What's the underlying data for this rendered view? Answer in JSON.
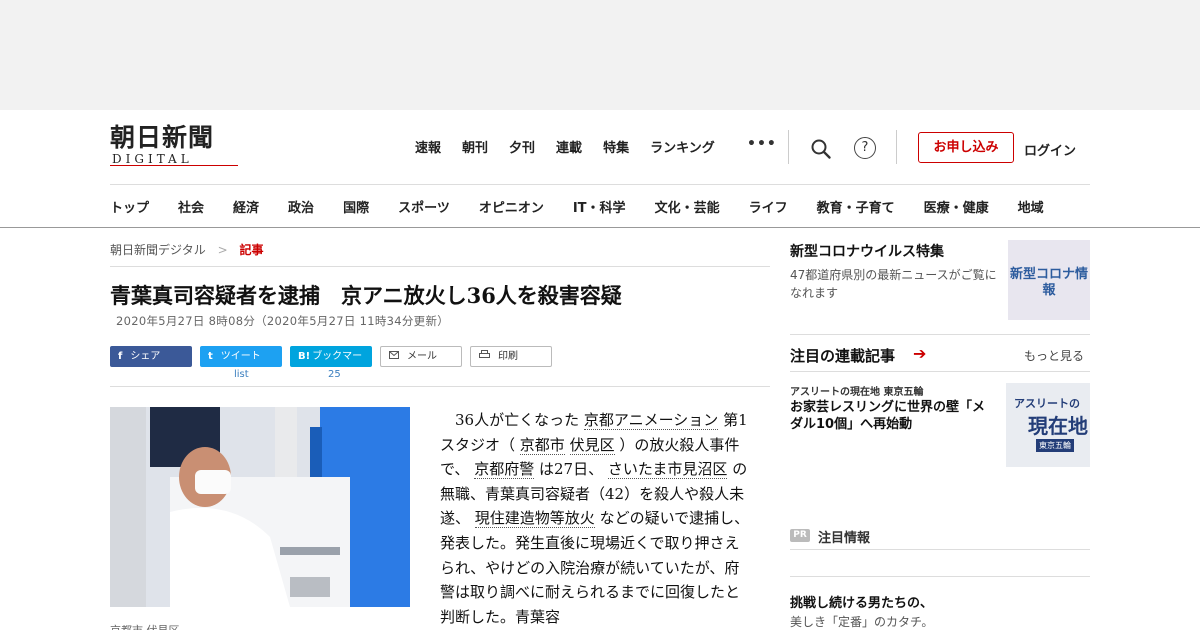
{
  "header": {
    "logo_jp": "朝日新聞",
    "logo_en": "DIGITAL",
    "topnav": [
      "速報",
      "朝刊",
      "夕刊",
      "連載",
      "特集",
      "ランキング"
    ],
    "more": "•••",
    "help": "?",
    "subscribe": "お申し込み",
    "login": "ログイン",
    "catnav": [
      "トップ",
      "社会",
      "経済",
      "政治",
      "国際",
      "スポーツ",
      "オピニオン",
      "IT・科学",
      "文化・芸能",
      "ライフ",
      "教育・子育て",
      "医療・健康",
      "地域"
    ]
  },
  "breadcrumb": {
    "home": "朝日新聞デジタル",
    "sep": ">",
    "current": "記事"
  },
  "article": {
    "title": "青葉真司容疑者を逮捕　京アニ放火し36人を殺害容疑",
    "date": "2020年5月27日 8時08分（2020年5月27日 11時34分更新）",
    "caption": "京都市 伏見区",
    "body": {
      "p1": "36人が亡くなった",
      "l1": "京都アニメーション",
      "p2": "第1スタジオ（",
      "l2": "京都市",
      "l3": "伏見区",
      "p3": "）の放火殺人事件で、",
      "l4": "京都府警",
      "p4": "は27日、",
      "l5": "さいたま市見沼区",
      "p5": "の無職、青葉真司容疑者（42）を殺人や殺人未遂、",
      "l6": "現住建造物等放火",
      "p6": "などの疑いで逮捕し、発表した。発生直後に現場近くで取り押さえられ、やけどの入院治療が続いていたが、府警は取り調べに耐えられるまでに回復したと判断した。青葉容"
    }
  },
  "share": {
    "fb": "シェア",
    "fb_icon": "f",
    "tw": "ツイート",
    "tw_icon": "t",
    "tw_count": "list",
    "hb": "ブックマーク",
    "hb_icon": "B!",
    "hb_count": "25",
    "mail": "メール",
    "print": "印刷"
  },
  "sidebar": {
    "covid_title": "新型コロナウイルス特集",
    "covid_desc": "47都道府県別の最新ニュースがご覧になれます",
    "covid_img": "新型コロナ情報",
    "series_title": "注目の連載記事",
    "series_arrow": "➔",
    "more": "もっと見る",
    "kicker": "アスリートの現在地 東京五輪",
    "headline": "お家芸レスリングに世界の壁「メダル10個」へ再始動",
    "img_t1": "アスリートの",
    "img_t2": "現在地",
    "img_t3": "東京五輪",
    "pr_badge": "PR",
    "pr_label": "注目情報",
    "pr_head": "挑戦し続ける男たちの、",
    "pr_sub": "美しき「定番」のカタチ。"
  },
  "colors": {
    "accent": "#cc0000",
    "facebook": "#3b5998",
    "twitter": "#1da1f2",
    "hatena": "#00a4de"
  }
}
